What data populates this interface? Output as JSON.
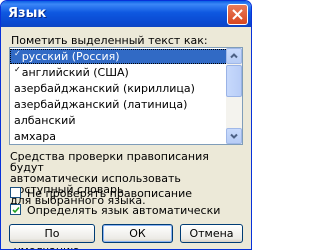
{
  "window": {
    "title": "Язык"
  },
  "label": {
    "text": "Пометить выделенный текст как:"
  },
  "languages": {
    "items": [
      {
        "label": "русский (Россия)",
        "checked": true,
        "selected": true
      },
      {
        "label": "английский (США)",
        "checked": true,
        "selected": false
      },
      {
        "label": "азербайджанский (кириллица)",
        "checked": false,
        "selected": false
      },
      {
        "label": "азербайджанский (латиница)",
        "checked": false,
        "selected": false
      },
      {
        "label": "албанский",
        "checked": false,
        "selected": false
      },
      {
        "label": "амхара",
        "checked": false,
        "selected": false
      }
    ]
  },
  "description": {
    "line1": "Средства проверки правописания будут",
    "line2": "автоматически использовать доступный словарь",
    "line3": "для выбранного языка."
  },
  "options": {
    "no_spellcheck": {
      "label": "Не проверять правописание",
      "checked": false
    },
    "auto_detect": {
      "label": "Определять язык автоматически",
      "checked": true
    }
  },
  "buttons": {
    "default": "По умолчанию...",
    "ok": "ОК",
    "cancel": "Отмена"
  }
}
